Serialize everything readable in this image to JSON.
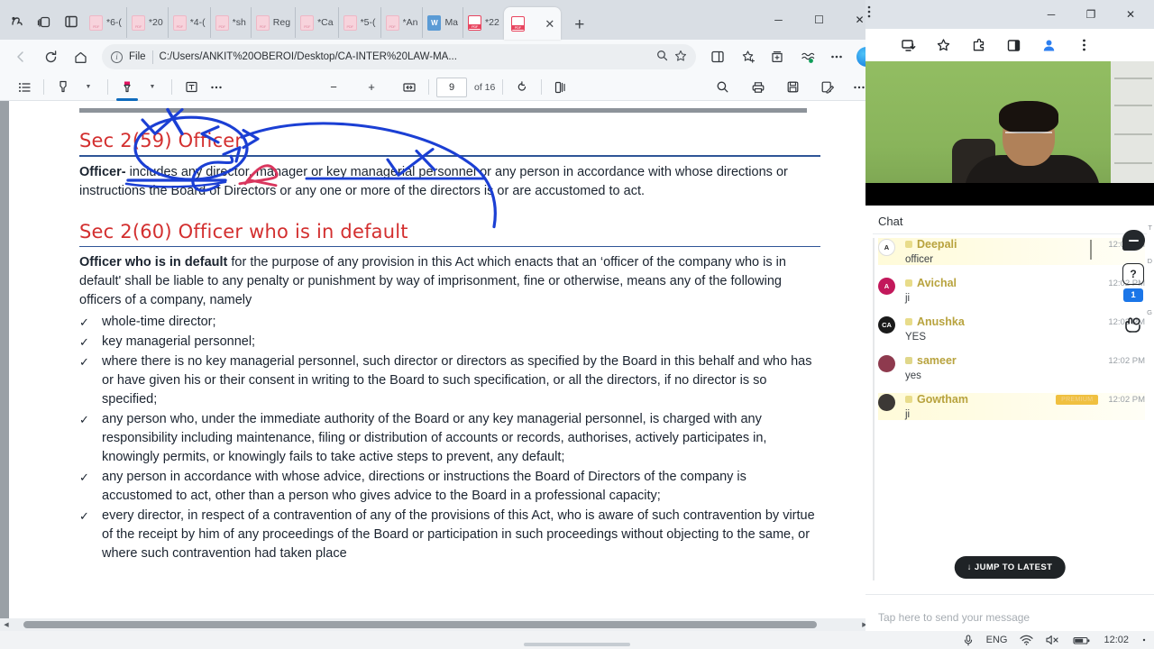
{
  "browser": {
    "tabs": [
      {
        "label": "*6-(",
        "favicon": "pdf-dim"
      },
      {
        "label": "*20",
        "favicon": "pdf-dim"
      },
      {
        "label": "*4-(",
        "favicon": "pdf-dim"
      },
      {
        "label": "*sh",
        "favicon": "pdf-dim"
      },
      {
        "label": "Reg",
        "favicon": "pdf-dim"
      },
      {
        "label": "*Ca",
        "favicon": "pdf-dim"
      },
      {
        "label": "*5-(",
        "favicon": "pdf-dim"
      },
      {
        "label": "*An",
        "favicon": "pdf-dim"
      },
      {
        "label": "Ma",
        "favicon": "word"
      },
      {
        "label": "*22",
        "favicon": "pdf-bright"
      }
    ],
    "active_tab": {
      "label": "",
      "favicon": "pdf-bright",
      "close": "✕"
    },
    "new_tab_label": "+",
    "window_controls": {
      "minimize": "─",
      "maximize": "☐",
      "close": "✕"
    },
    "address": {
      "file_chip": "File",
      "url": "C:/Users/ANKIT%20OBEROI/Desktop/CA-INTER%20LAW-MA...",
      "zoom_icon": "zoom-icon",
      "star_icon": "favorite-star-icon"
    },
    "toolbar_icons": [
      "split-screen-icon",
      "favorites-icon",
      "collections-icon",
      "browser-essentials-icon",
      "more-icon"
    ],
    "copilot": "copilot-icon"
  },
  "pdf_toolbar": {
    "toc_icon": "table-of-contents-icon",
    "highlight_icon": "highlighter-icon",
    "draw_icon": "pen-icon",
    "text_icon": "add-text-icon",
    "more_icon": "more-options-icon",
    "zoom_out": "−",
    "zoom_in": "+",
    "fit_page": "fit-page-icon",
    "page_number": "9",
    "page_total": "of 16",
    "rotate_icon": "rotate-icon",
    "layout_icon": "page-layout-icon",
    "search_icon": "search-icon",
    "print_icon": "print-icon",
    "save_icon": "save-icon",
    "saveas_icon": "save-as-icon",
    "overflow_icon": "more-icon"
  },
  "document": {
    "sections": [
      {
        "heading": "Sec 2(59) Officer",
        "paragraph_lead": "Officer-",
        "paragraph_rest": " includes any director, manager or key managerial personnel or any person in accordance with whose directions or instructions the Board of Directors or any one or more of the directors is or are accustomed to act.",
        "bullets": []
      },
      {
        "heading": "Sec 2(60) Officer who is in default",
        "paragraph_lead": "Officer who is in default",
        "paragraph_rest": " for the purpose of any provision in this Act which enacts that an ‘officer of the company who is in default' shall be liable to any penalty or punishment by way of imprisonment, fine or otherwise, means any of the following officers of a company, namely",
        "bullets": [
          "whole-time director;",
          "key managerial personnel;",
          "where there is no key managerial personnel, such director or directors as specified by the Board in this behalf and who has or have given his or their consent in writing to the Board to such specification, or all the directors, if no director is so specified;",
          "any person who, under the immediate authority of the Board or any key managerial personnel, is charged with any responsibility including maintenance, filing or distribution of accounts or records, authorises, actively participates in, knowingly permits, or knowingly fails to take active steps to prevent, any default;",
          "any person in accordance with whose advice, directions or instructions the Board of Directors of the company is accustomed to act, other than a person who gives advice to the Board in a professional capacity;",
          "every director, in respect of a contravention of any of the provisions of this Act, who is aware of such contravention by virtue of the receipt by him of any proceedings of the Board or participation in such proceedings without objecting to the same, or where such contravention had taken place"
        ]
      }
    ],
    "check_glyph": "✓",
    "annotation_color_blue": "#1b3fd4",
    "annotation_color_red": "#d9365e"
  },
  "right_window": {
    "title_controls": {
      "minimize": "─",
      "maximize": "❐",
      "close": "✕"
    },
    "toolbar_icons": [
      "install-app-icon",
      "favorite-star-icon",
      "extensions-icon",
      "split-screen-icon",
      "profile-icon",
      "more-vertical-icon"
    ]
  },
  "chat": {
    "title": "Chat",
    "messages": [
      {
        "user": "Deepali",
        "avatar_initials": "A",
        "avatar_color": "#ffffff",
        "time": "12:02 PM",
        "text": "officer",
        "badge": ""
      },
      {
        "user": "Avichal",
        "avatar_initials": "A",
        "avatar_color": "#c2185b",
        "time": "12:02 PM",
        "text": "ji",
        "badge": ""
      },
      {
        "user": "Anushka",
        "avatar_initials": "CA",
        "avatar_color": "#1a1a1a",
        "time": "12:02 PM",
        "text": "YES",
        "badge": ""
      },
      {
        "user": "sameer",
        "avatar_initials": "",
        "avatar_color": "#8e3a4e",
        "time": "12:02 PM",
        "text": "yes",
        "badge": ""
      },
      {
        "user": "Gowtham",
        "avatar_initials": "",
        "avatar_color": "#3c3835",
        "time": "12:02 PM",
        "text": "ji",
        "badge": "PREMIUM"
      }
    ],
    "jump_to_latest": "↓  JUMP TO LATEST",
    "input_placeholder": "Tap here to send your message"
  },
  "side_rail": [
    {
      "key": "T",
      "icon": "chat-bubble-icon",
      "count": ""
    },
    {
      "key": "D",
      "icon": "doubt-question-icon",
      "count": "1"
    },
    {
      "key": "G",
      "icon": "raise-hand-icon",
      "count": ""
    }
  ],
  "taskbar": {
    "mic_icon": "microphone-icon",
    "language": "ENG",
    "wifi_icon": "wifi-icon",
    "volume_icon": "volume-muted-icon",
    "battery_icon": "battery-icon",
    "time": "12:02",
    "notifications_icon": "notifications-icon"
  },
  "colors": {
    "accent_blue": "#0f6cbd",
    "heading_red": "#d32f2f",
    "chat_name": "#b8a33e",
    "rule_blue": "#2f5597"
  }
}
